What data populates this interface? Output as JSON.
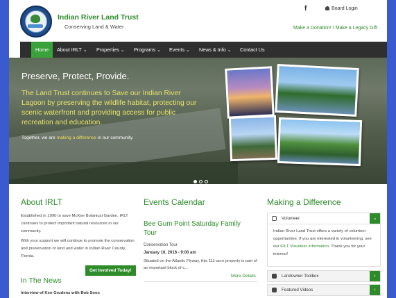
{
  "header": {
    "org_name": "Indian River Land Trust",
    "tagline": "Conserving Land & Water",
    "facebook_glyph": "f",
    "board_login": "Board Login",
    "donate_links": "Make a Donation! / Make a Legacy Gift"
  },
  "nav": {
    "items": [
      "Home",
      "About IRLT ⌄",
      "Properties ⌄",
      "Programs ⌄",
      "Events ⌄",
      "News & Info ⌄",
      "Contact Us"
    ],
    "active_color": "#3aa23a"
  },
  "hero": {
    "title": "Preserve, Protect, Provide.",
    "text": "The Land Trust continues to Save our Indian River Lagoon by preserving the wildlife habitat, protecting our scenic waterfront and providing access for public recreation and education.",
    "tag_before": "Together, we are ",
    "tag_highlight": "making a difference",
    "tag_after": " in our community.",
    "slide_count": 3,
    "active_slide": 1
  },
  "about": {
    "title": "About IRLT",
    "p1": "Established in 1990 to save McKee Botanical Garden, IRLT continues to protect important natural resources in our community.",
    "p2": "With your support we will continue to promote the conservation and preservation of land and water in Indian River County, Florida.",
    "button": "Get Involved Today!",
    "news_title": "In The News",
    "news_item": "Interview of Ken Grudens with Bob Soos"
  },
  "events": {
    "title": "Events Calendar",
    "event_title": "Bee Gum Point Saturday Family Tour",
    "category": "Conservation Tour",
    "date": "January 16, 2016 - 9:00 am",
    "desc": "Situated on the Atlantic Flyway, this 111-acre property is part of an important block of c...",
    "more": "More Details"
  },
  "difference": {
    "title": "Making a Difference",
    "volunteer": "Volunteer",
    "volunteer_body_before": "Indian River Land Trust offers a variety of volunteer opportunities. If you are interested in volunteering, see our ",
    "volunteer_link": "IRLT Volunteer Information",
    "volunteer_body_after": ". Thank you for your interest!",
    "toolbox": "Landowner Toolbox",
    "videos": "Featured Videos",
    "toggle_open": "⌄",
    "toggle_closed": "‹"
  },
  "colors": {
    "brand_green": "#2e8b2a",
    "hero_text": "#e7e36a",
    "nav_bg": "#2f2f2f",
    "frame_blue": "#3a5bd0"
  }
}
